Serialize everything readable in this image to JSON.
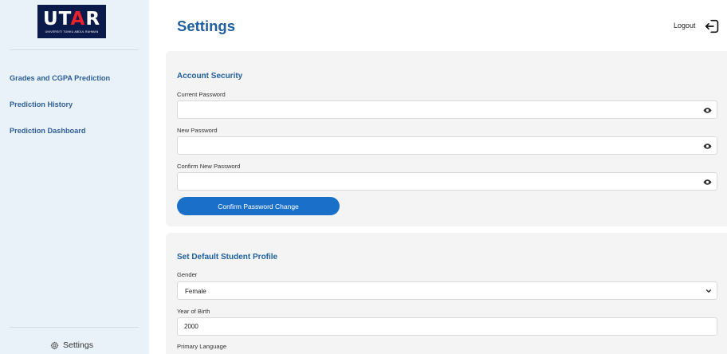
{
  "sidebar": {
    "logo": {
      "main_prefix": "UT",
      "main_accent": "A",
      "main_suffix": "R",
      "subtitle": "UNIVERSITI TUNKU ABDUL RAHMAN"
    },
    "items": [
      {
        "label": "Grades and CGPA Prediction"
      },
      {
        "label": "Prediction History"
      },
      {
        "label": "Prediction Dashboard"
      }
    ],
    "settings_label": "Settings"
  },
  "header": {
    "title": "Settings",
    "logout_label": "Logout"
  },
  "account_security": {
    "title": "Account Security",
    "current_password": {
      "label": "Current Password",
      "value": ""
    },
    "new_password": {
      "label": "New Password",
      "value": ""
    },
    "confirm_password": {
      "label": "Confirm New Password",
      "value": ""
    },
    "confirm_button": "Confirm Password Change"
  },
  "student_profile": {
    "title": "Set Default Student Profile",
    "gender": {
      "label": "Gender",
      "value": "Female"
    },
    "year_of_birth": {
      "label": "Year of Birth",
      "value": "2000"
    },
    "primary_language": {
      "label": "Primary Language"
    }
  },
  "colors": {
    "accent": "#1f5f9f",
    "button": "#1a6fc9",
    "sidebar_bg": "#e9f1f9",
    "card_bg": "#f4f4f4",
    "logo_bg": "#0a1a4a",
    "logo_accent": "#e8222e"
  }
}
